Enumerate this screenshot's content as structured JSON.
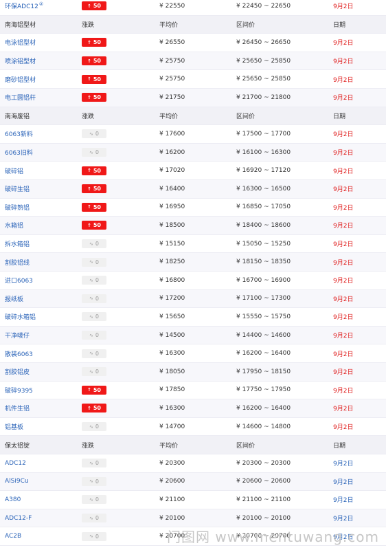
{
  "top_row": {
    "name": "环保ADC12",
    "change": "50",
    "change_dir": "up",
    "avg": "¥ 22550",
    "range": "¥ 22450 ~ 22650",
    "date": "9月2日",
    "date_color": "red"
  },
  "sections": [
    {
      "title": "南海铝型材",
      "headers": {
        "change": "涨跌",
        "avg": "平均价",
        "range": "区间价",
        "date": "日期"
      },
      "rows": [
        {
          "name": "电泳铝型材",
          "change": "50",
          "dir": "up",
          "avg": "¥ 26550",
          "range": "¥ 26450 ~ 26650",
          "date": "9月2日",
          "date_color": "red"
        },
        {
          "name": "喷涂铝型材",
          "change": "50",
          "dir": "up",
          "avg": "¥ 25750",
          "range": "¥ 25650 ~ 25850",
          "date": "9月2日",
          "date_color": "red"
        },
        {
          "name": "磨砂铝型材",
          "change": "50",
          "dir": "up",
          "avg": "¥ 25750",
          "range": "¥ 25650 ~ 25850",
          "date": "9月2日",
          "date_color": "red"
        },
        {
          "name": "电工圆铝杆",
          "change": "50",
          "dir": "up",
          "avg": "¥ 21750",
          "range": "¥ 21700 ~ 21800",
          "date": "9月2日",
          "date_color": "red"
        }
      ]
    },
    {
      "title": "南海废铝",
      "headers": {
        "change": "涨跌",
        "avg": "平均价",
        "range": "区间价",
        "date": "日期"
      },
      "rows": [
        {
          "name": "6063新料",
          "change": "0",
          "dir": "flat",
          "avg": "¥ 17600",
          "range": "¥ 17500 ~ 17700",
          "date": "9月2日",
          "date_color": "red"
        },
        {
          "name": "6063旧料",
          "change": "0",
          "dir": "flat",
          "avg": "¥ 16200",
          "range": "¥ 16100 ~ 16300",
          "date": "9月2日",
          "date_color": "red"
        },
        {
          "name": "破碎铝",
          "change": "50",
          "dir": "up",
          "avg": "¥ 17020",
          "range": "¥ 16920 ~ 17120",
          "date": "9月2日",
          "date_color": "red"
        },
        {
          "name": "破碎生铝",
          "change": "50",
          "dir": "up",
          "avg": "¥ 16400",
          "range": "¥ 16300 ~ 16500",
          "date": "9月2日",
          "date_color": "red"
        },
        {
          "name": "破碎熟铝",
          "change": "50",
          "dir": "up",
          "avg": "¥ 16950",
          "range": "¥ 16850 ~ 17050",
          "date": "9月2日",
          "date_color": "red"
        },
        {
          "name": "水箱铝",
          "change": "50",
          "dir": "up",
          "avg": "¥ 18500",
          "range": "¥ 18400 ~ 18600",
          "date": "9月2日",
          "date_color": "red"
        },
        {
          "name": "拆水箱铝",
          "change": "0",
          "dir": "flat",
          "avg": "¥ 15150",
          "range": "¥ 15050 ~ 15250",
          "date": "9月2日",
          "date_color": "red"
        },
        {
          "name": "割胶铝线",
          "change": "0",
          "dir": "flat",
          "avg": "¥ 18250",
          "range": "¥ 18150 ~ 18350",
          "date": "9月2日",
          "date_color": "red"
        },
        {
          "name": "进口6063",
          "change": "0",
          "dir": "flat",
          "avg": "¥ 16800",
          "range": "¥ 16700 ~ 16900",
          "date": "9月2日",
          "date_color": "red"
        },
        {
          "name": "报纸板",
          "change": "0",
          "dir": "flat",
          "avg": "¥ 17200",
          "range": "¥ 17100 ~ 17300",
          "date": "9月2日",
          "date_color": "red"
        },
        {
          "name": "破碎水箱铝",
          "change": "0",
          "dir": "flat",
          "avg": "¥ 15650",
          "range": "¥ 15550 ~ 15750",
          "date": "9月2日",
          "date_color": "red"
        },
        {
          "name": "干净唛仔",
          "change": "0",
          "dir": "flat",
          "avg": "¥ 14500",
          "range": "¥ 14400 ~ 14600",
          "date": "9月2日",
          "date_color": "red"
        },
        {
          "name": "散装6063",
          "change": "0",
          "dir": "flat",
          "avg": "¥ 16300",
          "range": "¥ 16200 ~ 16400",
          "date": "9月2日",
          "date_color": "red"
        },
        {
          "name": "割胶铝皮",
          "change": "0",
          "dir": "flat",
          "avg": "¥ 18050",
          "range": "¥ 17950 ~ 18150",
          "date": "9月2日",
          "date_color": "red"
        },
        {
          "name": "破碎9395",
          "change": "50",
          "dir": "up",
          "avg": "¥ 17850",
          "range": "¥ 17750 ~ 17950",
          "date": "9月2日",
          "date_color": "red"
        },
        {
          "name": "机件生铝",
          "change": "50",
          "dir": "up",
          "avg": "¥ 16300",
          "range": "¥ 16200 ~ 16400",
          "date": "9月2日",
          "date_color": "red"
        },
        {
          "name": "铝基板",
          "change": "0",
          "dir": "flat",
          "avg": "¥ 14700",
          "range": "¥ 14600 ~ 14800",
          "date": "9月2日",
          "date_color": "red"
        }
      ]
    },
    {
      "title": "保太铝锭",
      "headers": {
        "change": "涨跌",
        "avg": "平均价",
        "range": "区间价",
        "date": "日期"
      },
      "rows": [
        {
          "name": "ADC12",
          "change": "0",
          "dir": "flat",
          "avg": "¥ 20300",
          "range": "¥ 20300 ~ 20300",
          "date": "9月2日",
          "date_color": "blue"
        },
        {
          "name": "AlSi9Cu",
          "change": "0",
          "dir": "flat",
          "avg": "¥ 20600",
          "range": "¥ 20600 ~ 20600",
          "date": "9月2日",
          "date_color": "blue"
        },
        {
          "name": "A380",
          "change": "0",
          "dir": "flat",
          "avg": "¥ 21100",
          "range": "¥ 21100 ~ 21100",
          "date": "9月2日",
          "date_color": "blue"
        },
        {
          "name": "ADC12-F",
          "change": "0",
          "dir": "flat",
          "avg": "¥ 20100",
          "range": "¥ 20100 ~ 20100",
          "date": "9月2日",
          "date_color": "blue"
        },
        {
          "name": "AC2B",
          "change": "0",
          "dir": "flat",
          "avg": "¥ 20700",
          "range": "¥ 20700 ~ 20700",
          "date": "9月2日",
          "date_color": "blue"
        }
      ]
    }
  ],
  "icons": {
    "up": "arrow-up-icon",
    "flat": "flat-trend-icon",
    "superscript": "info-superscript-icon"
  },
  "colors": {
    "up_badge": "#f01818",
    "flat_badge": "#f0f0f0",
    "link": "#2a63b8",
    "date_red": "#e02020",
    "date_blue": "#2a63b8"
  },
  "watermark": "门图网 www.mentuwang.com"
}
